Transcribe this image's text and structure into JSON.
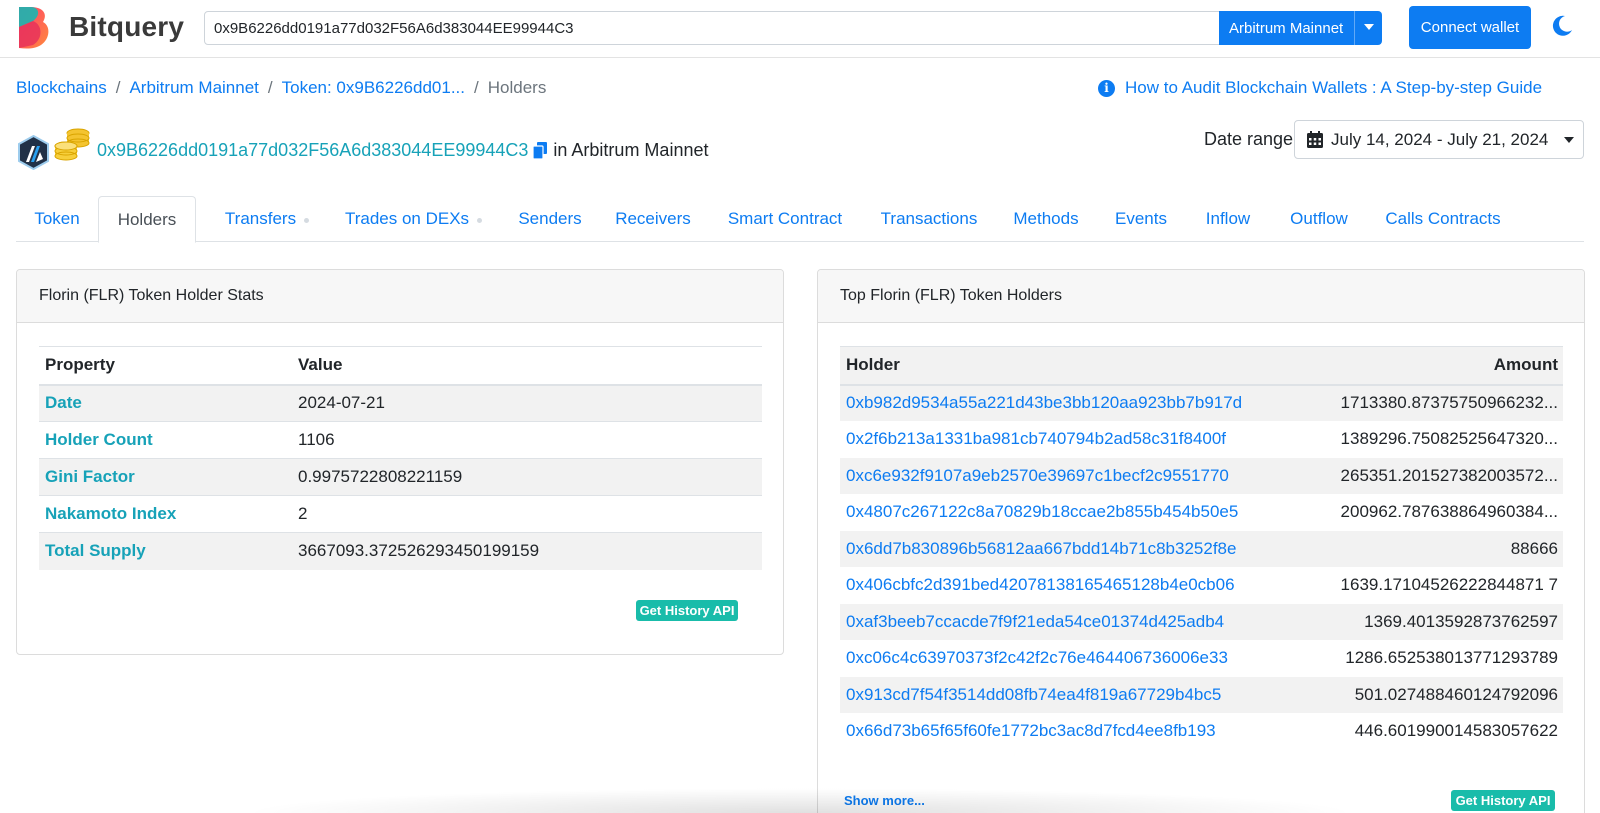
{
  "header": {
    "brand": "Bitquery",
    "search_value": "0x9B6226dd0191a77d032F56A6d383044EE99944C3",
    "network": "Arbitrum Mainnet",
    "connect_label": "Connect wallet"
  },
  "breadcrumb": {
    "items": [
      "Blockchains",
      "Arbitrum Mainnet",
      "Token: 0x9B6226dd01..."
    ],
    "current": "Holders"
  },
  "guide_link": "How to Audit Blockchain Wallets : A Step-by-step Guide",
  "token": {
    "address": "0x9B6226dd0191a77d032F56A6d383044EE99944C3",
    "network_suffix": "in Arbitrum Mainnet"
  },
  "date_range": {
    "label": "Date range",
    "value": "July 14, 2024 - July 21, 2024"
  },
  "tabs": [
    "Token",
    "Holders",
    "Transfers",
    "Trades on DEXs",
    "Senders",
    "Receivers",
    "Smart Contract",
    "Transactions",
    "Methods",
    "Events",
    "Inflow",
    "Outflow",
    "Calls Contracts"
  ],
  "stats": {
    "title": "Florin (FLR) Token Holder Stats",
    "col_property": "Property",
    "col_value": "Value",
    "rows": [
      {
        "property": "Date",
        "value": "2024-07-21"
      },
      {
        "property": "Holder Count",
        "value": "1106"
      },
      {
        "property": "Gini Factor",
        "value": "0.9975722808221159"
      },
      {
        "property": "Nakamoto Index",
        "value": "2"
      },
      {
        "property": "Total Supply",
        "value": "3667093.372526293450199159"
      }
    ],
    "api_label": "Get History API"
  },
  "holders": {
    "title": "Top Florin (FLR) Token Holders",
    "col_holder": "Holder",
    "col_amount": "Amount",
    "rows": [
      {
        "address": "0xb982d9534a55a221d43be3bb120aa923bb7b917d",
        "amount": "1713380.87375750966232..."
      },
      {
        "address": "0x2f6b213a1331ba981cb740794b2ad58c31f8400f",
        "amount": "1389296.75082525647320..."
      },
      {
        "address": "0xc6e932f9107a9eb2570e39697c1becf2c9551770",
        "amount": "265351.201527382003572..."
      },
      {
        "address": "0x4807c267122c8a70829b18ccae2b855b454b50e5",
        "amount": "200962.787638864960384..."
      },
      {
        "address": "0x6dd7b830896b56812aa667bdd14b71c8b3252f8e",
        "amount": "88666"
      },
      {
        "address": "0x406cbfc2d391bed42078138165465128b4e0cb06",
        "amount": "1639.17104526222844871 7"
      },
      {
        "address": "0xaf3beeb7ccacde7f9f21eda54ce01374d425adb4",
        "amount": "1369.4013592873762597"
      },
      {
        "address": "0xc06c4c63970373f2c42f2c76e464406736006e33",
        "amount": "1286.652538013771293789"
      },
      {
        "address": "0x913cd7f54f3514dd08fb74ea4f819a67729b4bc5",
        "amount": "501.027488460124792096"
      },
      {
        "address": "0x66d73b65f65f60fe1772bc3ac8d7fcd4ee8fb193",
        "amount": "446.601990014583057622"
      }
    ],
    "show_more": "Show more...",
    "api_label": "Get History API"
  },
  "colors": {
    "primary": "#0d7cf2",
    "teal": "#17a2b8",
    "badge": "#19bcaa"
  },
  "icons": [
    "bitquery-logo-icon",
    "moon-icon",
    "info-icon",
    "arbitrum-icon",
    "coins-icon",
    "copy-icon",
    "calendar-icon",
    "caret-down-icon"
  ]
}
